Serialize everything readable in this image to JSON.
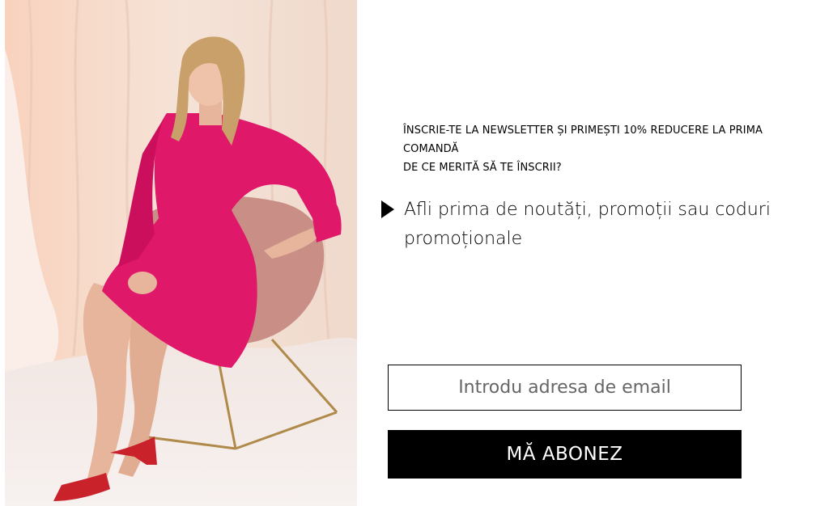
{
  "promo_image": {
    "alt": "",
    "background_color": "#f4e0d4",
    "dress_color": "#e0186a",
    "chair_color": "#c98f87",
    "shoes_color": "#c9222b"
  },
  "newsletter": {
    "headline_line1": "ÎNSCRIE-TE LA NEWSLETTER ȘI PRIMEȘTI 10% REDUCERE LA PRIMA",
    "headline_line2": "COMANDĂ",
    "headline_line3": "DE CE MERITĂ SĂ TE ÎNSCRII?",
    "bullet_icon": "triangle-right-icon",
    "benefit_text": "Afli prima de noutăți, promoții sau coduri promoționale",
    "email_placeholder": "Introdu adresa de email",
    "email_value": "",
    "subscribe_label": "MĂ ABONEZ",
    "accent_color": "#000000"
  }
}
